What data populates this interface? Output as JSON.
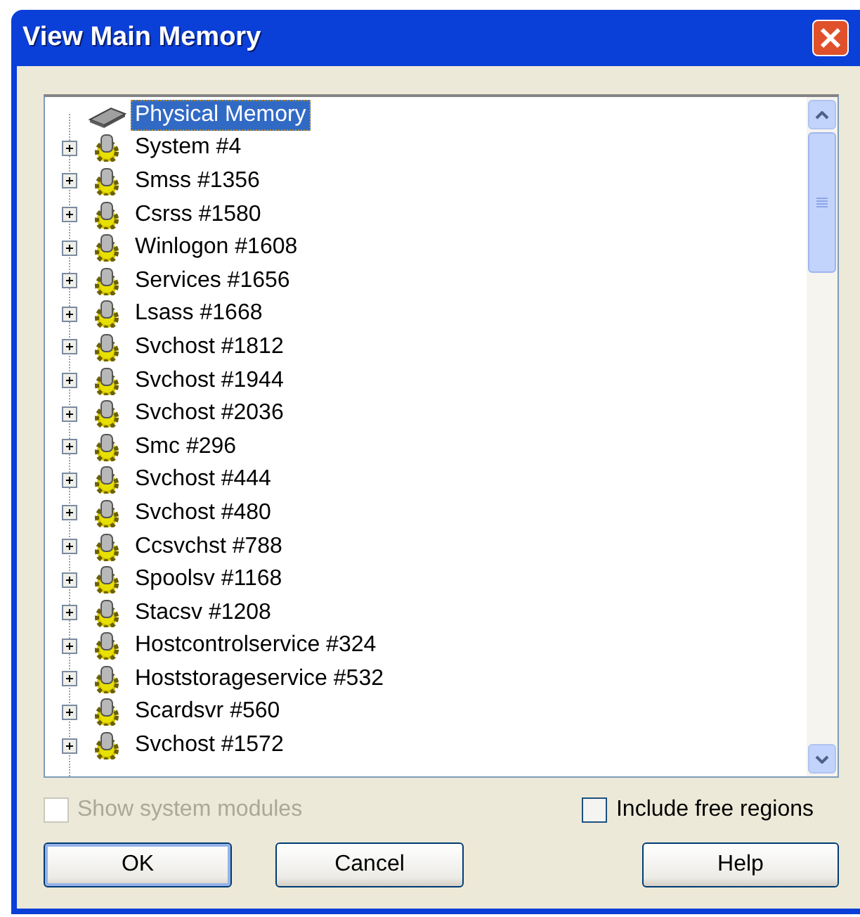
{
  "window": {
    "title": "View Main Memory"
  },
  "tree": {
    "items": [
      {
        "label": "Physical Memory",
        "kind": "memory",
        "selected": true
      },
      {
        "label": "System #4",
        "kind": "process",
        "selected": false,
        "expanded": false
      },
      {
        "label": "Smss #1356",
        "kind": "process",
        "selected": false,
        "expanded": false
      },
      {
        "label": "Csrss #1580",
        "kind": "process",
        "selected": false,
        "expanded": false
      },
      {
        "label": "Winlogon #1608",
        "kind": "process",
        "selected": false,
        "expanded": false
      },
      {
        "label": "Services #1656",
        "kind": "process",
        "selected": false,
        "expanded": false
      },
      {
        "label": "Lsass #1668",
        "kind": "process",
        "selected": false,
        "expanded": false
      },
      {
        "label": "Svchost #1812",
        "kind": "process",
        "selected": false,
        "expanded": false
      },
      {
        "label": "Svchost #1944",
        "kind": "process",
        "selected": false,
        "expanded": false
      },
      {
        "label": "Svchost #2036",
        "kind": "process",
        "selected": false,
        "expanded": false
      },
      {
        "label": "Smc #296",
        "kind": "process",
        "selected": false,
        "expanded": false
      },
      {
        "label": "Svchost #444",
        "kind": "process",
        "selected": false,
        "expanded": false
      },
      {
        "label": "Svchost #480",
        "kind": "process",
        "selected": false,
        "expanded": false
      },
      {
        "label": "Ccsvchst #788",
        "kind": "process",
        "selected": false,
        "expanded": false
      },
      {
        "label": "Spoolsv #1168",
        "kind": "process",
        "selected": false,
        "expanded": false
      },
      {
        "label": "Stacsv #1208",
        "kind": "process",
        "selected": false,
        "expanded": false
      },
      {
        "label": "Hostcontrolservice #324",
        "kind": "process",
        "selected": false,
        "expanded": false
      },
      {
        "label": "Hoststorageservice #532",
        "kind": "process",
        "selected": false,
        "expanded": false
      },
      {
        "label": "Scardsvr #560",
        "kind": "process",
        "selected": false,
        "expanded": false
      },
      {
        "label": "Svchost #1572",
        "kind": "process",
        "selected": false,
        "expanded": false
      }
    ]
  },
  "options": [
    {
      "label": "Show system modules",
      "checked": false,
      "disabled": true
    },
    {
      "label": "Include free regions",
      "checked": false,
      "disabled": false
    }
  ],
  "buttons": [
    {
      "label": "OK",
      "default": true
    },
    {
      "label": "Cancel",
      "default": false
    },
    {
      "label": "Help",
      "default": false
    }
  ]
}
